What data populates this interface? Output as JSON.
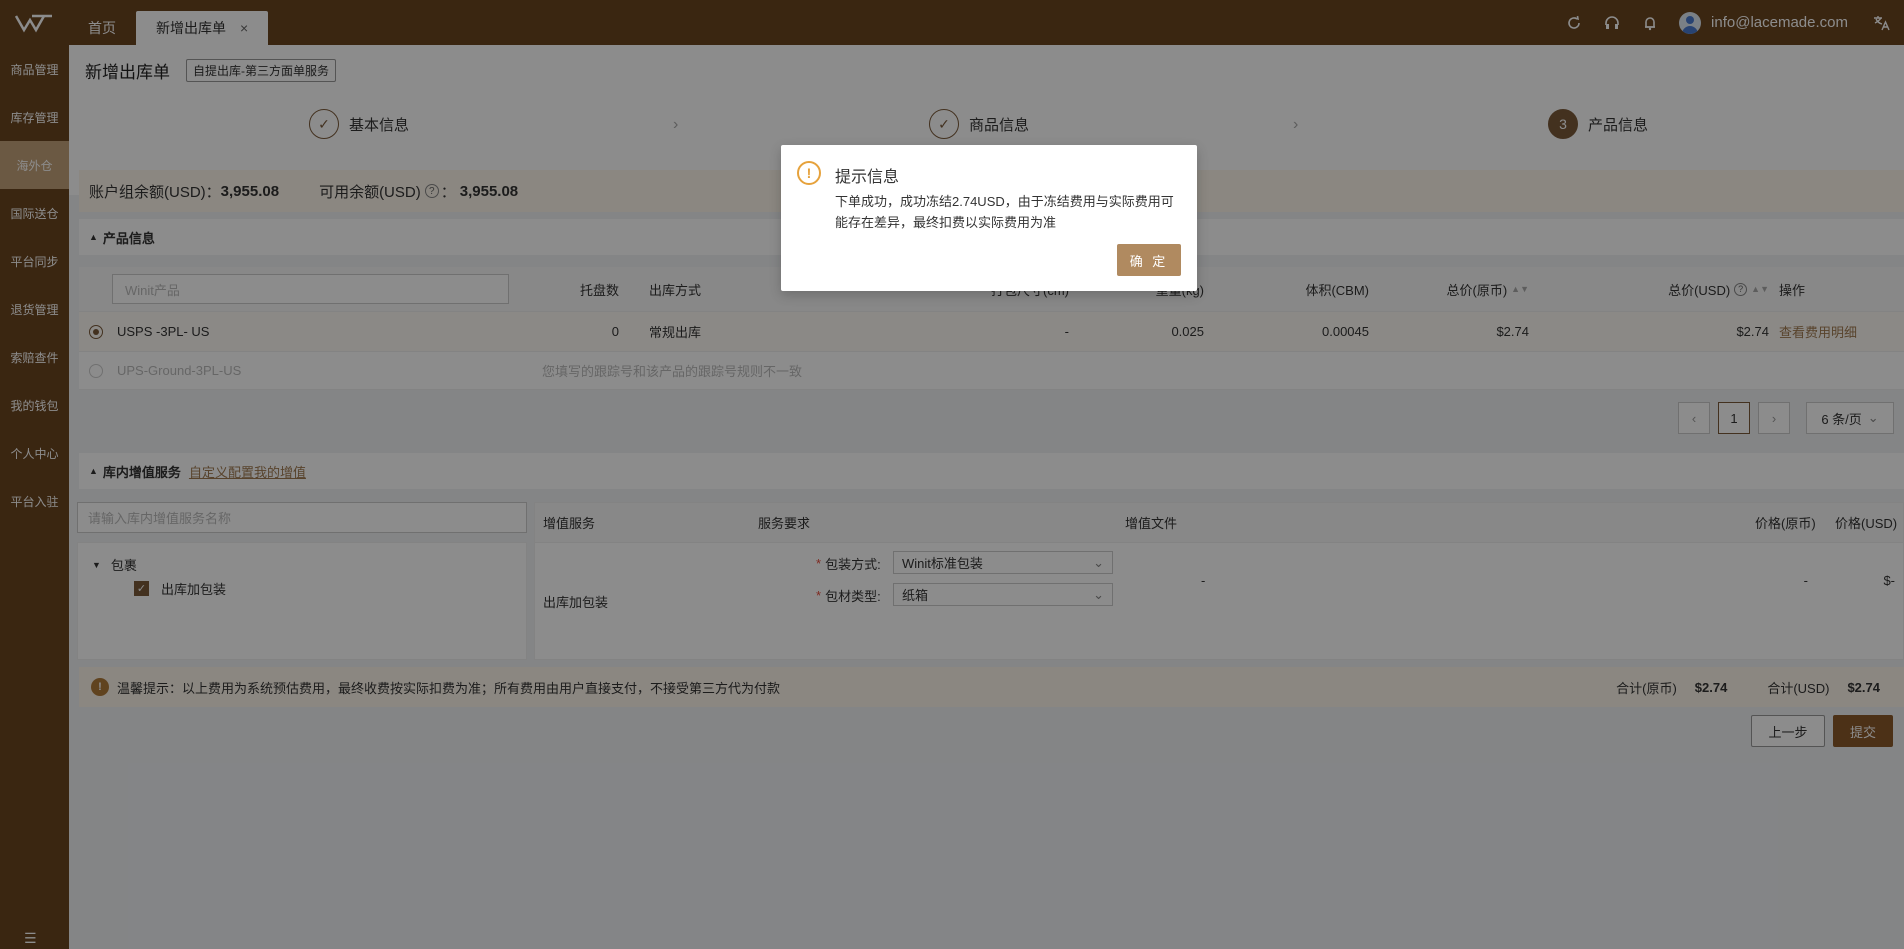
{
  "topbar": {
    "tabs": [
      {
        "label": "首页"
      },
      {
        "label": "新增出库单"
      }
    ],
    "user_email": "info@lacemade.com"
  },
  "sidebar": {
    "items": [
      {
        "label": "商品管理"
      },
      {
        "label": "库存管理"
      },
      {
        "label": "海外仓"
      },
      {
        "label": "国际送仓"
      },
      {
        "label": "平台同步"
      },
      {
        "label": "退货管理"
      },
      {
        "label": "索赔查件"
      },
      {
        "label": "我的钱包"
      },
      {
        "label": "个人中心"
      },
      {
        "label": "平台入驻"
      }
    ],
    "active_index": 2
  },
  "page": {
    "title": "新增出库单",
    "tag": "自提出库-第三方面单服务"
  },
  "steps": [
    {
      "label": "基本信息",
      "state": "done"
    },
    {
      "label": "商品信息",
      "state": "done"
    },
    {
      "label": "产品信息",
      "state": "current",
      "number": "3"
    }
  ],
  "balance": {
    "group_label": "账户组余额(USD)：",
    "group_value": "3,955.08",
    "available_label": "可用余额(USD)",
    "available_sep": "：",
    "available_value": "3,955.08"
  },
  "product_section": {
    "title": "产品信息",
    "search_placeholder": "Winit产品",
    "columns": {
      "pallets": "托盘数",
      "method": "出库方式",
      "pack_size": "打包尺寸(cm)",
      "weight": "重量(kg)",
      "volume": "体积(CBM)",
      "total_orig": "总价(原币)",
      "total_usd": "总价(USD)",
      "action": "操作"
    },
    "rows": [
      {
        "name": "USPS -3PL- US",
        "pallets": "0",
        "method": "常规出库",
        "pack_size": "-",
        "weight": "0.025",
        "volume": "0.00045",
        "total_orig": "$2.74",
        "total_usd": "$2.74",
        "action": "查看费用明细"
      },
      {
        "name": "UPS-Ground-3PL-US",
        "note": "您填写的跟踪号和该产品的跟踪号规则不一致"
      }
    ],
    "pager": {
      "page": "1",
      "size": "6 条/页"
    }
  },
  "vas_section": {
    "title": "库内增值服务",
    "config_link": "自定义配置我的增值",
    "search_placeholder": "请输入库内增值服务名称",
    "tree": {
      "group": "包裹",
      "item": "出库加包装"
    },
    "columns": {
      "service": "增值服务",
      "requirement": "服务要求",
      "file": "增值文件",
      "price_orig": "价格(原币)",
      "price_usd": "价格(USD)"
    },
    "row": {
      "service": "出库加包装",
      "pack_method_label": "包装方式:",
      "pack_method_value": "Winit标准包装",
      "material_label": "包材类型:",
      "material_value": "纸箱",
      "file": "-",
      "price_orig": "-",
      "price_usd": "$-"
    }
  },
  "tip": {
    "text": "温馨提示：以上费用为系统预估费用，最终收费按实际扣费为准；所有费用由用户直接支付，不接受第三方代为付款",
    "total_orig_label": "合计(原币)",
    "total_orig_value": "$2.74",
    "total_usd_label": "合计(USD)",
    "total_usd_value": "$2.74"
  },
  "actions": {
    "prev": "上一步",
    "submit": "提交"
  },
  "dialog": {
    "title": "提示信息",
    "message": "下单成功，成功冻结2.74USD，由于冻结费用与实际费用可能存在差异，最终扣费以实际费用为准",
    "ok": "确 定"
  },
  "colors": {
    "brand": "#6b4520",
    "accent": "#a07a50",
    "warning": "#e6a23c"
  }
}
